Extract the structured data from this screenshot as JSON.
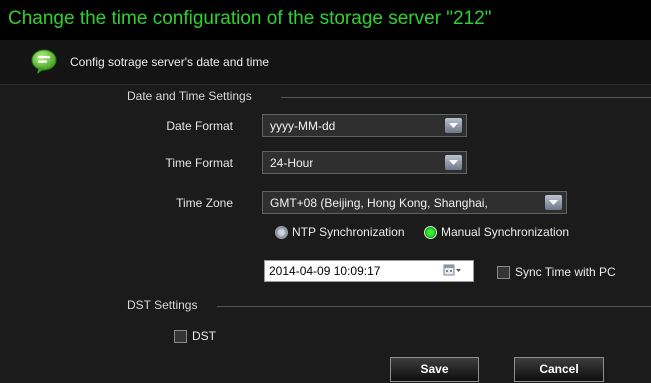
{
  "header": {
    "title": "Change the time configuration of the storage server \"212\"",
    "subtitle": "Config sotrage server's date and time",
    "icon": "chat-bubble-icon"
  },
  "date_time_settings": {
    "label": "Date and Time Settings",
    "date_format": {
      "label": "Date Format",
      "value": "yyyy-MM-dd"
    },
    "time_format": {
      "label": "Time Format",
      "value": "24-Hour"
    },
    "time_zone": {
      "label": "Time Zone",
      "value": "GMT+08 (Beijing, Hong Kong, Shanghai,"
    },
    "sync_mode": {
      "options": [
        "NTP Synchronization",
        "Manual Synchronization"
      ],
      "selected": "Manual Synchronization"
    },
    "datetime_value": "2014-04-09 10:09:17",
    "sync_with_pc": {
      "label": "Sync Time with PC",
      "checked": false
    }
  },
  "dst_settings": {
    "label": "DST Settings",
    "dst": {
      "label": "DST",
      "checked": false
    }
  },
  "buttons": {
    "save": "Save",
    "cancel": "Cancel"
  },
  "colors": {
    "title": "#2fd12f",
    "selected_radio": "#37ee37"
  }
}
